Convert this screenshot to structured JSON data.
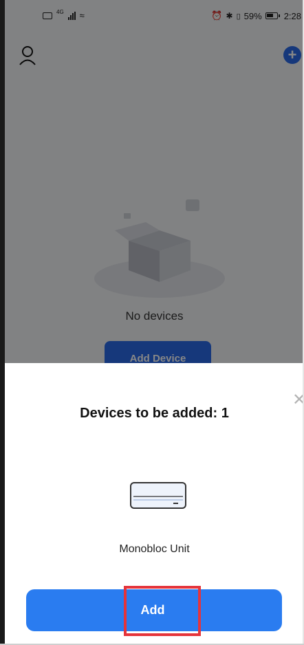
{
  "status_bar": {
    "signal_label": "4G",
    "battery_percent": "59%",
    "time": "2:28"
  },
  "background_screen": {
    "empty_text": "No devices",
    "add_device_button": "Add Device"
  },
  "sheet": {
    "title": "Devices to be added: 1",
    "device_name": "Monobloc Unit",
    "add_button": "Add",
    "close_icon": "close-icon",
    "device_icon": "air-conditioner-unit-icon"
  },
  "colors": {
    "primary_blue": "#2a7cf0",
    "highlight_red": "#e5343b",
    "dim_overlay": "rgba(0,0,0,0.47)"
  }
}
